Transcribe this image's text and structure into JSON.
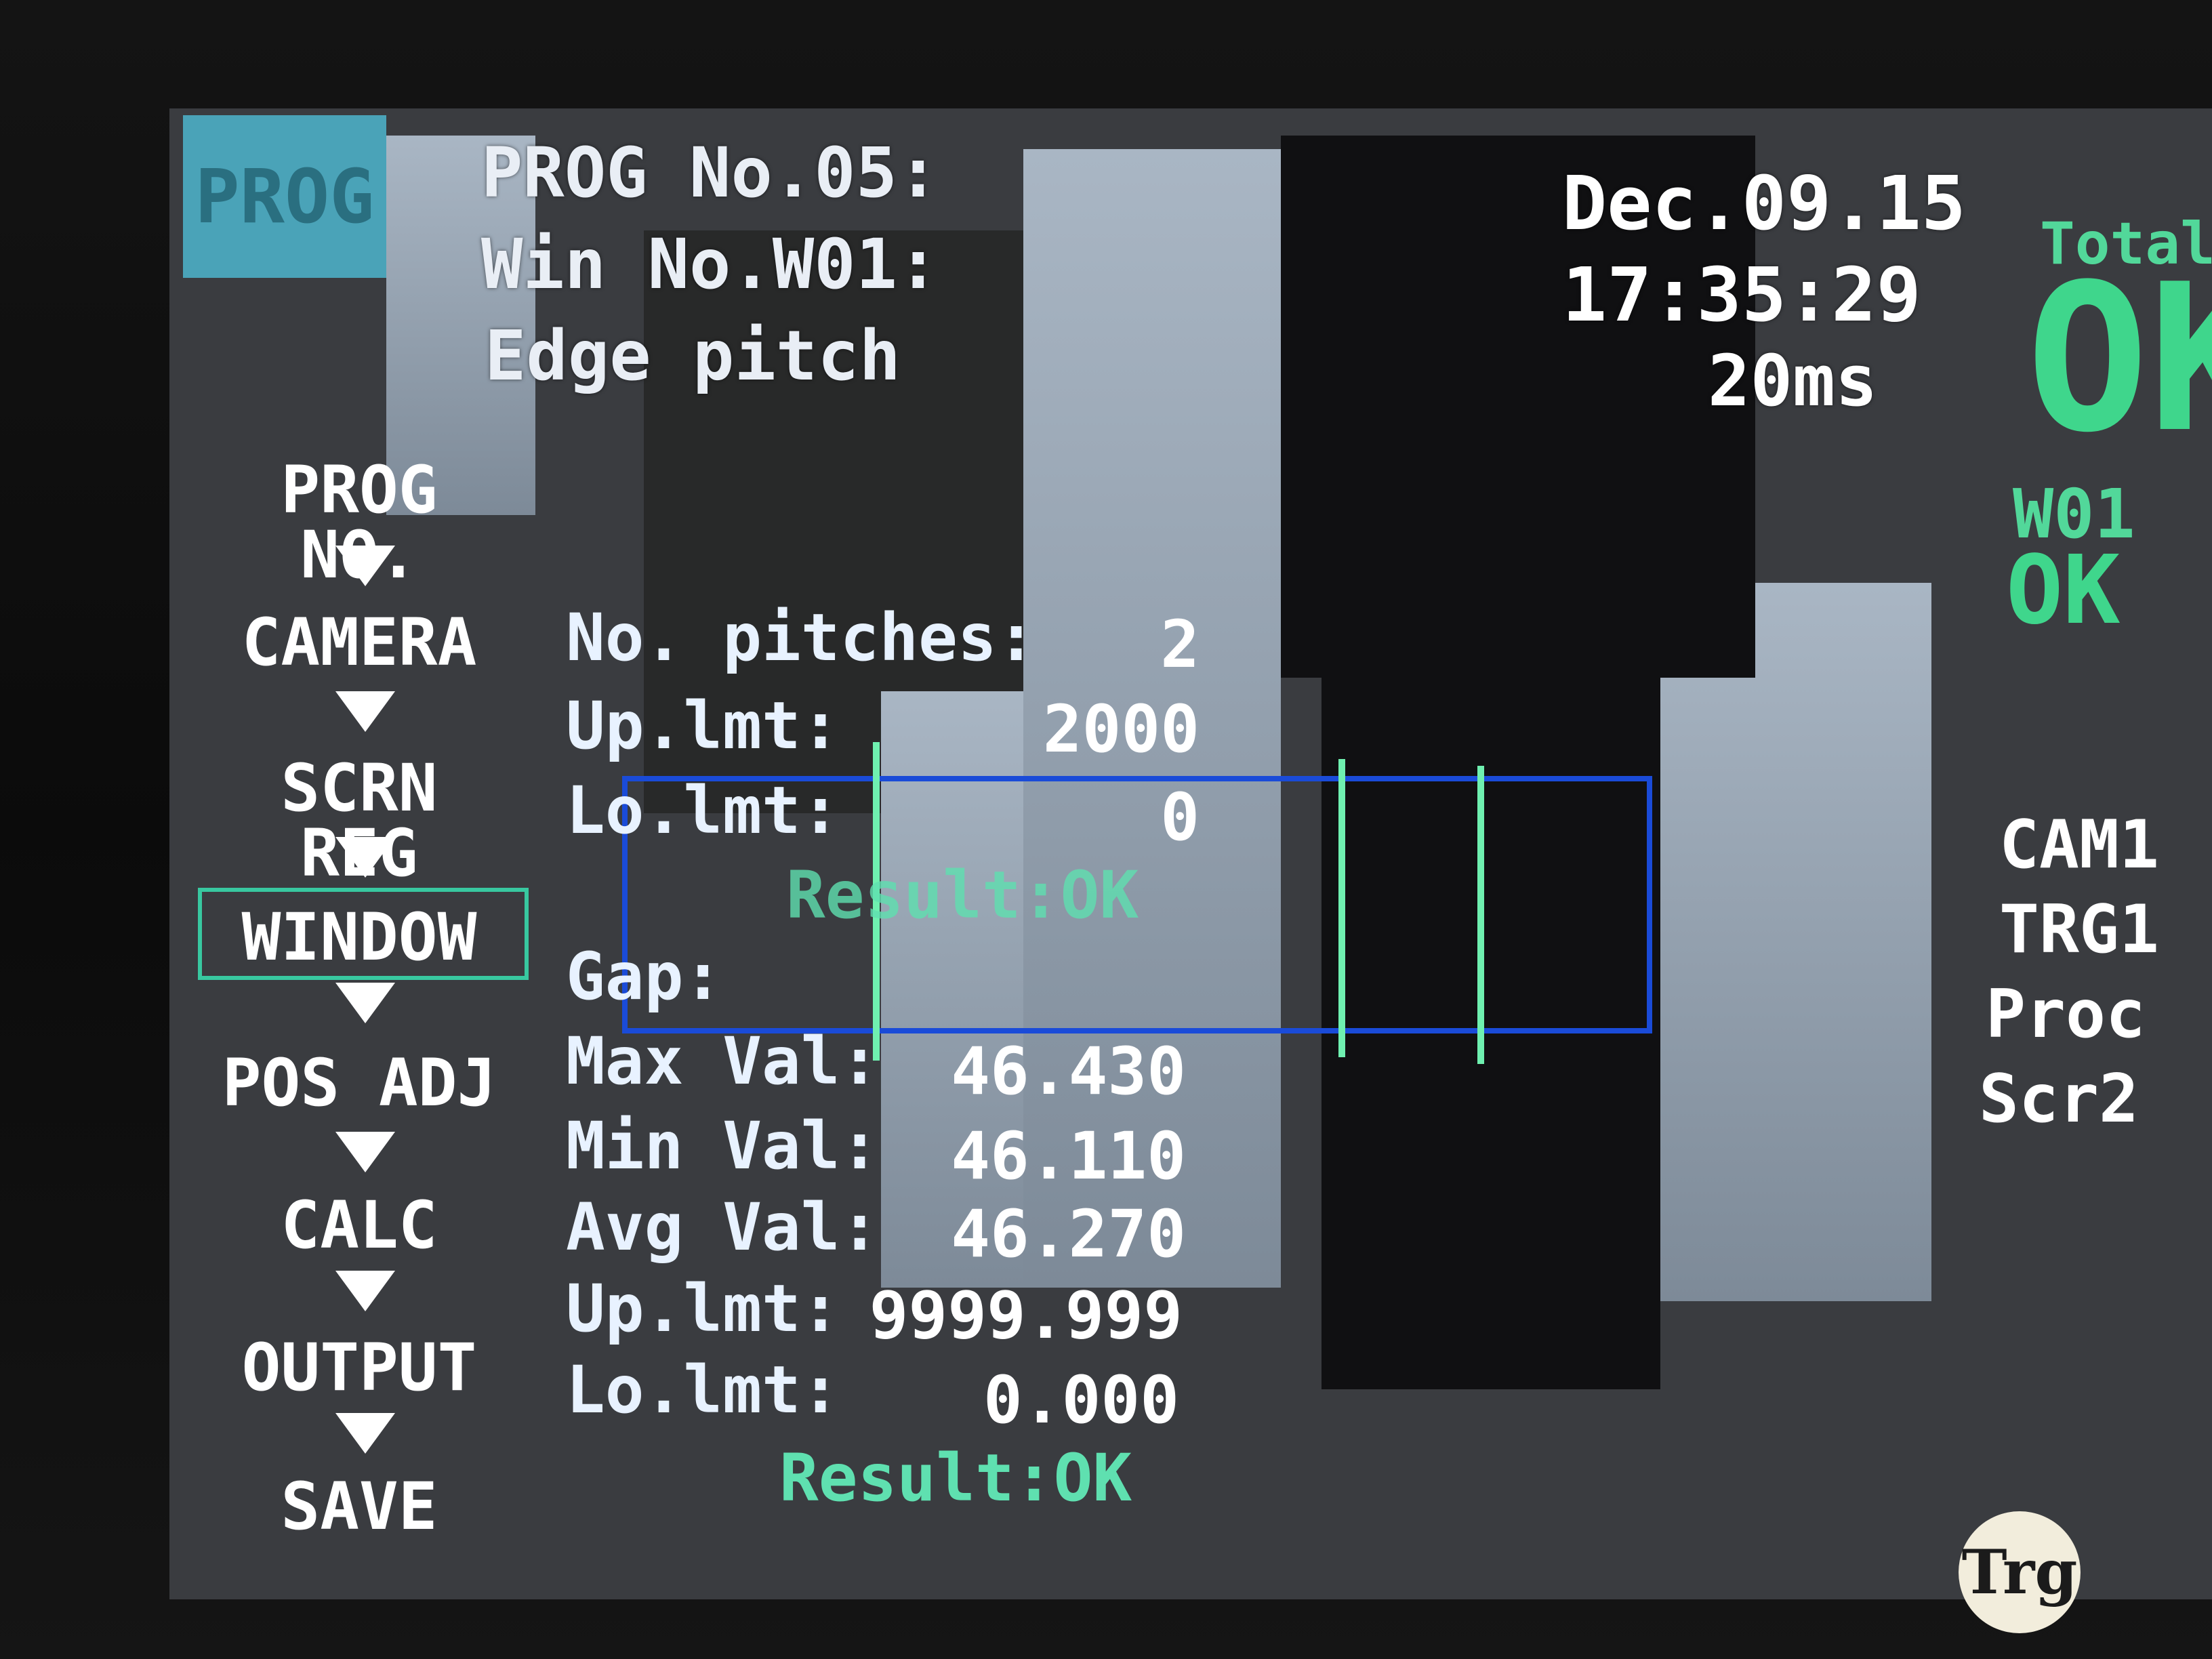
{
  "header": {
    "mode_tag": "PROG",
    "prog_line": "PROG No.05:",
    "win_line": "Win No.W01:",
    "tool_line": "Edge pitch",
    "date": "Dec.09.15",
    "time": "17:35:29",
    "proc_time": "20ms"
  },
  "status": {
    "total_label": "Total",
    "total_value": "OK",
    "window_label": "W01",
    "window_value": "OK"
  },
  "menu": {
    "items": [
      "PROG NO.",
      "CAMERA",
      "SCRN REG",
      "WINDOW",
      "POS ADJ",
      "CALC",
      "OUTPUT",
      "SAVE"
    ],
    "active": "WINDOW"
  },
  "settings": {
    "pitches_label": "No. pitches:",
    "pitches_value": "2",
    "up_label": "Up.lmt:",
    "up_value": "2000",
    "lo_label": "Lo.lmt:",
    "lo_value": "0",
    "result_text": "Result:OK"
  },
  "measure": {
    "gap_label": "Gap:",
    "max_label": "Max Val:",
    "max_value": "46.430",
    "min_label": "Min Val:",
    "min_value": "46.110",
    "avg_label": "Avg Val:",
    "avg_value": "46.270",
    "up_label": "Up.lmt:",
    "up_value": "9999.999",
    "lo_label": "Lo.lmt:",
    "lo_value": "0.000",
    "result_text": "Result:OK"
  },
  "side_panel": {
    "cam": "CAM1",
    "trg": "TRG1",
    "proc": "Proc",
    "scr": "Scr2"
  },
  "trigger_icon": "Trg",
  "colors": {
    "ok_green": "#3fd68c",
    "result_green": "#5fe0b0",
    "window_frame": "#1a4bd8",
    "active_menu_border": "#38c8a0",
    "prog_tag_bg": "#4aa3b8"
  }
}
